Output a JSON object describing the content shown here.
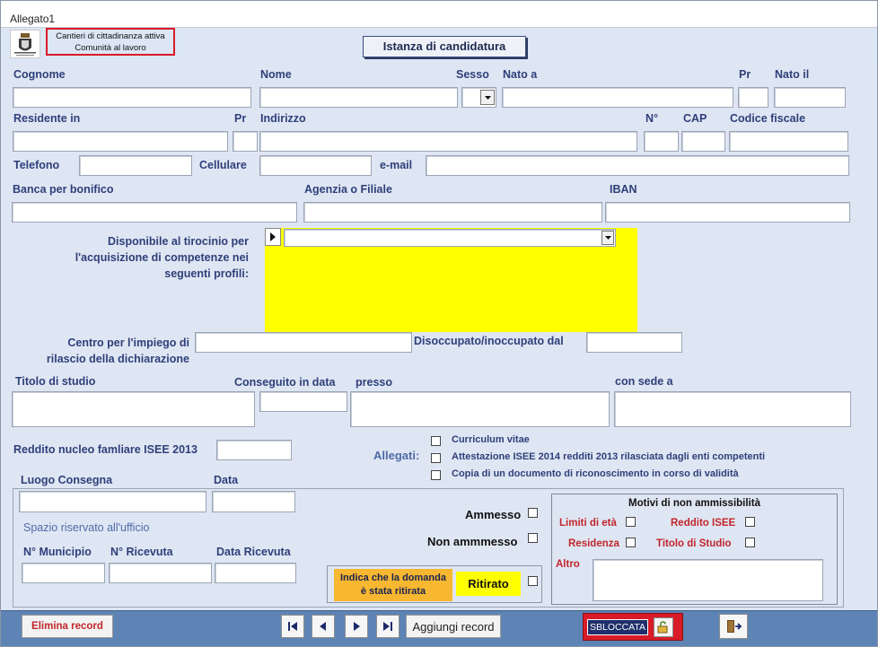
{
  "window": {
    "title": "Allegato1"
  },
  "header": {
    "logo_icon": "municipal-crest-icon",
    "project_line1": "Cantieri di cittadinanza attiva",
    "project_line2": "Comunità al lavoro",
    "form_title": "Istanza di candidatura"
  },
  "personal": {
    "cognome": "Cognome",
    "nome": "Nome",
    "sesso": "Sesso",
    "nato_a": "Nato a",
    "pr": "Pr",
    "nato_il": "Nato il",
    "residente_in": "Residente in",
    "pr2": "Pr",
    "indirizzo": "Indirizzo",
    "numero": "N°",
    "cap": "CAP",
    "codice_fiscale": "Codice fiscale",
    "telefono": "Telefono",
    "cellulare": "Cellulare",
    "email": "e-mail",
    "banca": "Banca per bonifico",
    "agenzia": "Agenzia o Filiale",
    "iban": "IBAN"
  },
  "profili": {
    "label_line1": "Disponibile al tirocinio per",
    "label_line2": "l'acquisizione di competenze nei",
    "label_line3": "seguenti profili:",
    "highlight_color": "#ffff00"
  },
  "centro": {
    "label_line1": "Centro per l'impiego di",
    "label_line2": "rilascio della dichiarazione",
    "disoccupato": "Disoccupato/inoccupato dal"
  },
  "studio": {
    "titolo": "Titolo di studio",
    "conseguito": "Conseguito in data",
    "presso": "presso",
    "sede": "con sede a"
  },
  "isee": {
    "label": "Reddito nucleo famliare ISEE 2013"
  },
  "allegati": {
    "label": "Allegati:",
    "items": [
      "Curriculum vitae",
      "Attestazione ISEE 2014 redditi 2013 rilasciata dagli enti competenti",
      "Copia di un documento di riconoscimento in corso di validità"
    ]
  },
  "consegna": {
    "luogo": "Luogo Consegna",
    "data": "Data",
    "spazio": "Spazio riservato all'ufficio",
    "municipio": "N° Municipio",
    "ricevuta": "N° Ricevuta",
    "data_ricevuta": "Data Ricevuta"
  },
  "esito": {
    "ammesso": "Ammesso",
    "non_ammesso": "Non ammmesso"
  },
  "ritiro": {
    "note_line1": "Indica che la domanda",
    "note_line2": "è stata ritirata",
    "ritirato": "Ritirato",
    "note_color": "#f7b731",
    "badge_color": "#ffff00"
  },
  "motivi": {
    "title": "Motivi di non ammissibilità",
    "limiti": "Limiti di età",
    "reddito": "Reddito ISEE",
    "residenza": "Residenza",
    "titolo": "Titolo di Studio",
    "altro": "Altro"
  },
  "footer": {
    "elimina": "Elimina record",
    "aggiungi": "Aggiungi record",
    "status": "SBLOCCATA",
    "accent": "#d81b27"
  }
}
